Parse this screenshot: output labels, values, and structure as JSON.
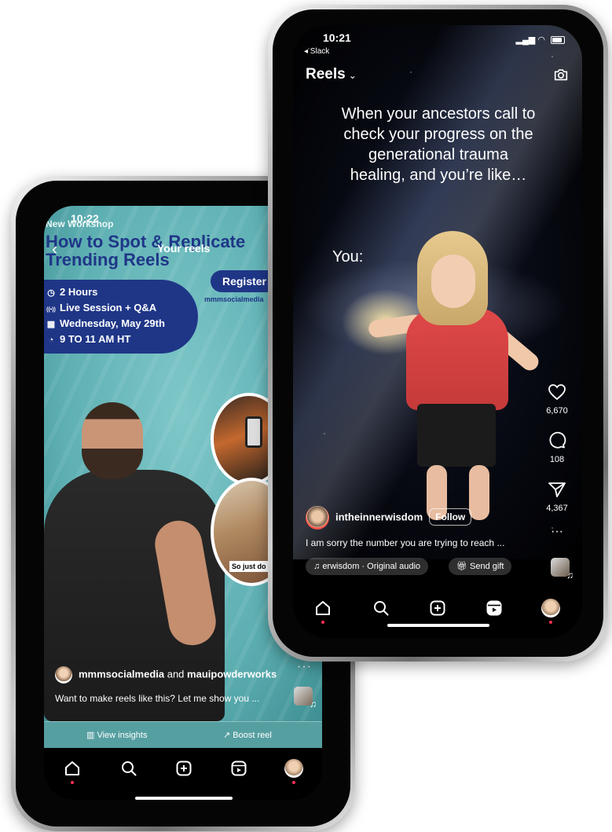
{
  "back_phone": {
    "status_time": "10:22",
    "overlay": {
      "label": "New Workshop",
      "title": "How to Spot & Replicate Trending Reels",
      "details": [
        {
          "icon": "clock-icon",
          "glyph": "◷",
          "text": "2 Hours"
        },
        {
          "icon": "broadcast-icon",
          "glyph": "((•))",
          "text": "Live Session + Q&A"
        },
        {
          "icon": "calendar-icon",
          "glyph": "▦",
          "text": "Wednesday, May 29th"
        },
        {
          "icon": "time-icon",
          "glyph": "◔",
          "text": "9 TO 11 AM HT"
        }
      ],
      "register": "Register",
      "site": "mmmsocialmedia"
    },
    "header_title": "Your reels",
    "badge_text": "So just do it",
    "reel": {
      "username": "mmmsocialmedia",
      "connector": " and ",
      "collab": "mauipowderworks",
      "caption": "Want to make reels like this? Let me show you ...",
      "more": "···"
    },
    "actions": {
      "view_insights": "View insights",
      "boost_reel": "Boost reel"
    }
  },
  "front_phone": {
    "status_time": "10:21",
    "back_app": "◂ Slack",
    "header_title": "Reels",
    "overlay_caption": "When your ancestors call to check your progress on the generational trauma healing, and you’re like…",
    "overlay_you": "You:",
    "reel": {
      "username": "intheinnerwisdom",
      "follow": "Follow",
      "caption": "I am sorry the number you are trying to reach ...",
      "audio": "erwisdom · Original audio",
      "send_gift": "Send gift"
    },
    "counts": {
      "likes": "6,670",
      "comments": "108",
      "shares": "4,367"
    },
    "more": "···"
  }
}
